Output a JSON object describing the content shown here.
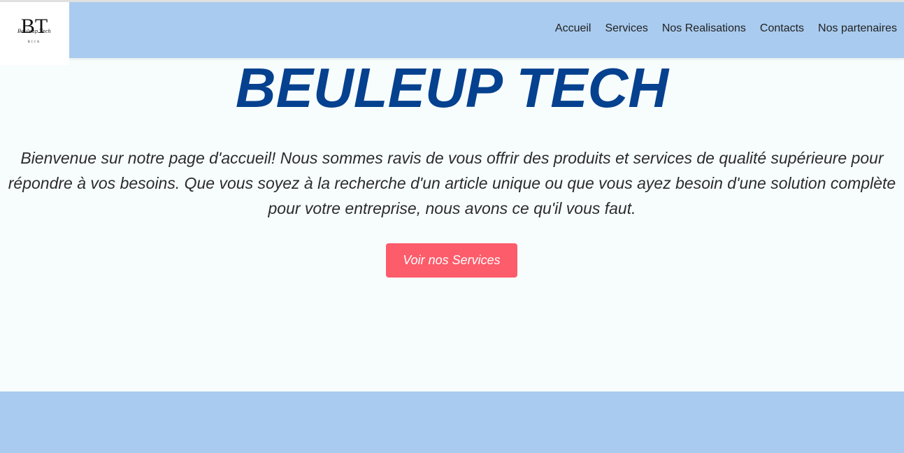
{
  "header": {
    "logo": {
      "monogram": "BT",
      "script_text": "Beuleup Tech",
      "caption": "RIJA"
    },
    "nav": [
      {
        "label": "Accueil"
      },
      {
        "label": "Services"
      },
      {
        "label": "Nos Realisations"
      },
      {
        "label": "Contacts"
      },
      {
        "label": "Nos partenaires"
      }
    ]
  },
  "hero": {
    "title": "BEULEUP TECH",
    "intro": "Bienvenue sur notre page d'accueil! Nous sommes ravis de vous offrir des produits et services de qualité supérieure pour répondre à vos besoins. Que vous soyez à la recherche d'un article unique ou que vous ayez besoin d'une solution complète pour votre entreprise, nous avons ce qu'il vous faut.",
    "cta_label": "Voir nos Services"
  },
  "colors": {
    "header_bg": "#a9cbef",
    "title": "#05418f",
    "cta_bg": "#fd5c6b",
    "page_bg": "#f7fdfd"
  }
}
